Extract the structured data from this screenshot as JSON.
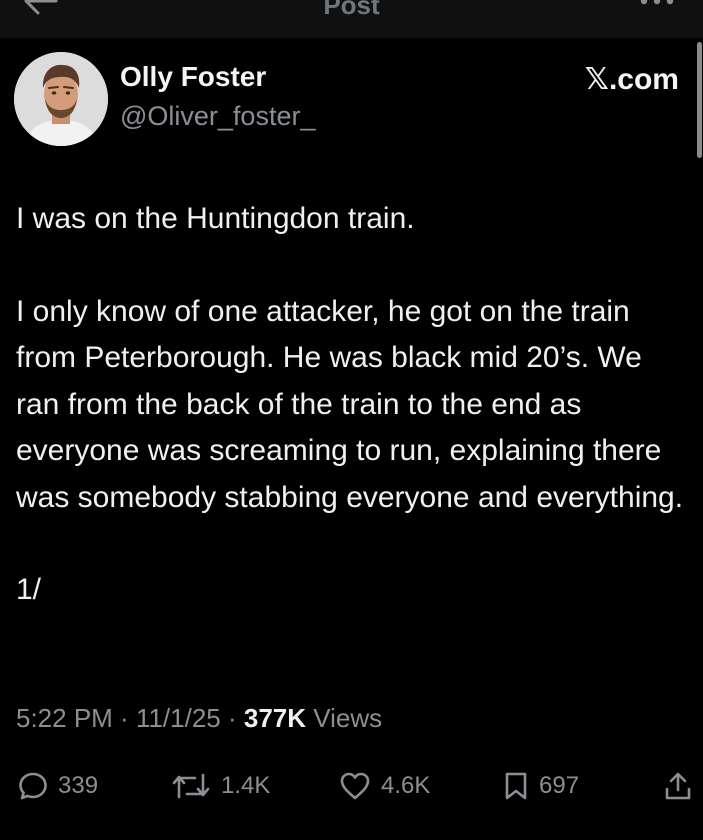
{
  "header": {
    "title": "Post"
  },
  "author": {
    "display_name": "Olly Foster",
    "handle": "@Oliver_foster_"
  },
  "source": "𝕏.com",
  "post": {
    "paragraphs": [
      "I was on the Huntingdon train.",
      "I only know of one attacker, he got on the train from Peterborough. He was black mid 20’s. We ran from the back of the train to the end as everyone was screaming to run, explaining there was somebody stabbing everyone and everything.",
      "1/"
    ]
  },
  "meta": {
    "time": "5:22 PM",
    "separator": " · ",
    "date": "11/1/25",
    "views_count": "377K",
    "views_label": "Views"
  },
  "actions": {
    "replies": "339",
    "reposts": "1.4K",
    "likes": "4.6K",
    "bookmarks": "697"
  },
  "icons": {
    "back": "back-arrow-icon",
    "more": "more-icon",
    "reply": "reply-icon",
    "repost": "repost-icon",
    "like": "like-icon",
    "bookmark": "bookmark-icon",
    "share": "share-icon"
  },
  "colors": {
    "background": "#000000",
    "text_primary": "#e7e9ea",
    "text_secondary": "#8b8f94"
  }
}
